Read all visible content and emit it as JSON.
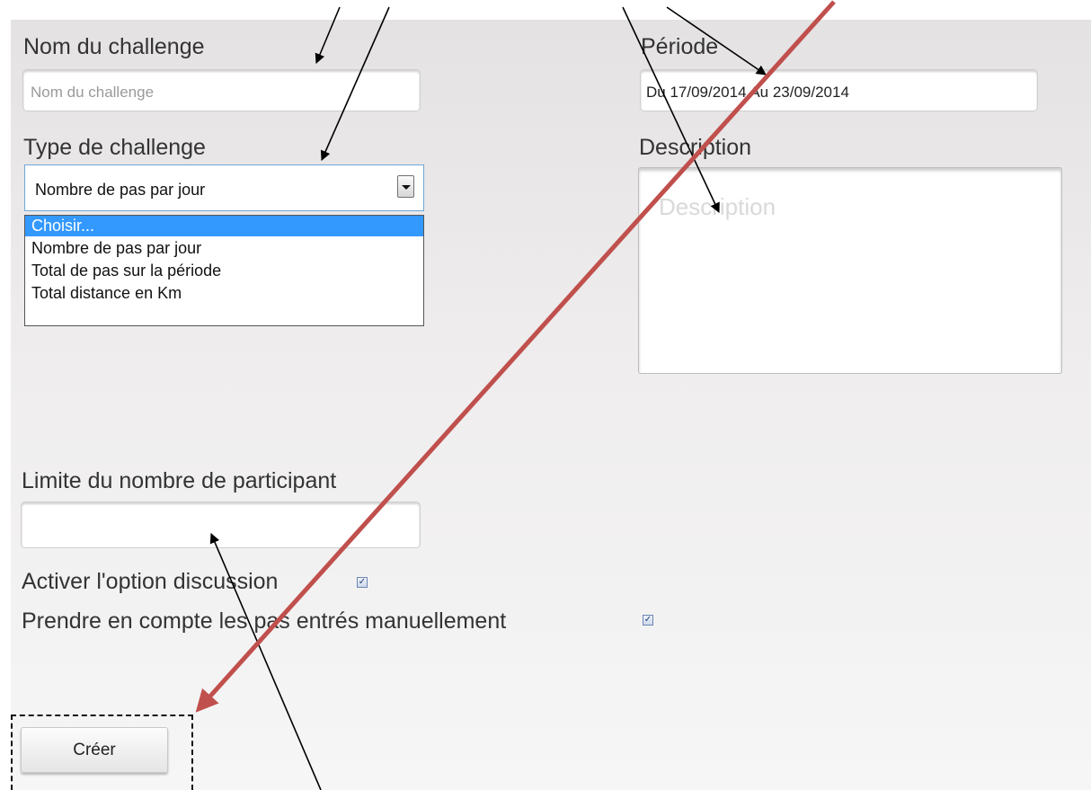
{
  "form": {
    "name": {
      "label": "Nom du challenge",
      "placeholder": "Nom du challenge",
      "value": ""
    },
    "period": {
      "label": "Période",
      "value": "Du 17/09/2014 Au 23/09/2014"
    },
    "type": {
      "label": "Type de challenge",
      "selected": "Nombre de pas par jour",
      "options": [
        "Choisir...",
        "Nombre de pas par jour",
        "Total de pas sur la période",
        "Total distance en Km"
      ],
      "highlighted_index": 0
    },
    "description": {
      "label": "Description",
      "placeholder": "Description",
      "value": ""
    },
    "limit": {
      "label": "Limite du nombre de participant",
      "value": ""
    },
    "discussion": {
      "label": "Activer l'option discussion",
      "checked": true
    },
    "manual_steps": {
      "label": "Prendre en compte les pas entrés manuellement",
      "checked": true
    },
    "submit_label": "Créer"
  },
  "icons": {
    "dropdown": "chevron-down-icon",
    "checkbox": "checkmark-icon"
  },
  "colors": {
    "annotation_arrow": "#000000",
    "annotation_red_arrow": "#c0504d",
    "option_highlight": "#3399ff",
    "select_border": "#6fa7d6"
  }
}
